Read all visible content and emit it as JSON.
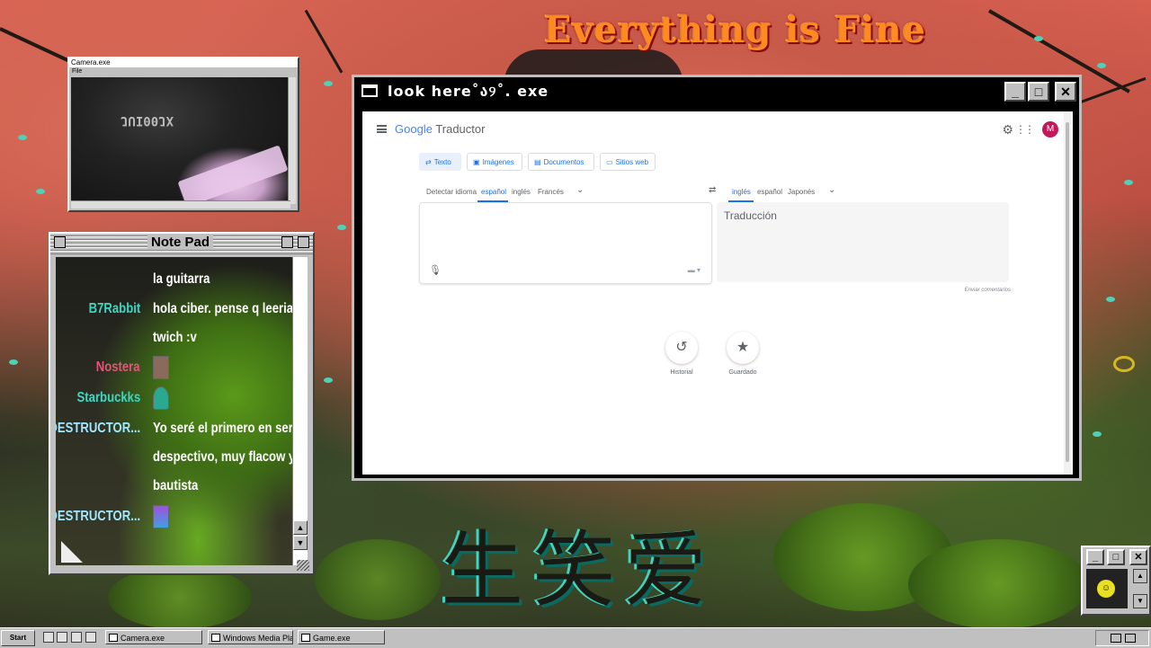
{
  "desktop": {
    "banner_text": "Everything is Fine",
    "kanji_text": "生笑爱"
  },
  "camera_window": {
    "title": "Camera.exe",
    "menu": "File",
    "shirt_text": "JUI00JX"
  },
  "notepad": {
    "title": "Note Pad",
    "messages": [
      {
        "user": "",
        "text": "la guitarra"
      },
      {
        "user": "B7Rabbit",
        "text": "hola ciber. pense q leerias"
      },
      {
        "user": "",
        "text": "twich :v"
      },
      {
        "user": "Nostera",
        "text": ""
      },
      {
        "user": "Starbuckks",
        "text": ""
      },
      {
        "user": "DESTRUCTOR...",
        "text": "Yo seré el primero en ser"
      },
      {
        "user": "",
        "text": "despectivo, muy flacow y"
      },
      {
        "user": "",
        "text": "bautista"
      },
      {
        "user": "DESTRUCTOR...",
        "text": ""
      }
    ],
    "colors": {
      "b7rabbit": "#3fd6c0",
      "nostera": "#e0557a",
      "starbuckks": "#3fd6c0",
      "destructor": "#9fe8ff",
      "text": "#ffffff"
    }
  },
  "main_window": {
    "title": "look here˚ა୨˚. exe",
    "app": {
      "logo_google": "Google",
      "logo_product": "Traductor",
      "avatar_letter": "M",
      "tabs": [
        "Texto",
        "Imágenes",
        "Documentos",
        "Sitios web"
      ],
      "source_langs": [
        "Detectar idioma",
        "español",
        "inglés",
        "Francés"
      ],
      "target_langs": [
        "inglés",
        "español",
        "Japonés"
      ],
      "target_placeholder": "Traducción",
      "feedback_link": "Enviar comentarios",
      "history_label": "Historial",
      "saved_label": "Guardado"
    }
  },
  "taskbar": {
    "start_label": "Start",
    "tasks": [
      "Camera.exe",
      "Windows Media Pla",
      "Game.exe"
    ]
  }
}
